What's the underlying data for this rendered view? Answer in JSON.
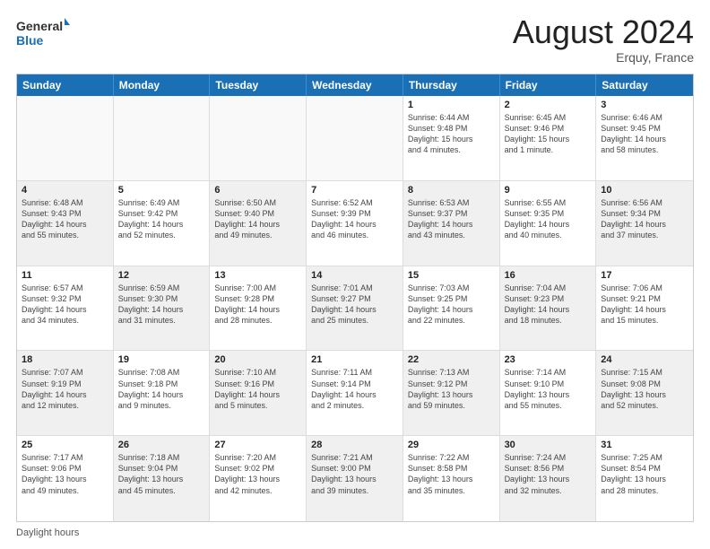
{
  "logo": {
    "line1": "General",
    "line2": "Blue"
  },
  "title": "August 2024",
  "location": "Erquy, France",
  "days_of_week": [
    "Sunday",
    "Monday",
    "Tuesday",
    "Wednesday",
    "Thursday",
    "Friday",
    "Saturday"
  ],
  "footer": "Daylight hours",
  "weeks": [
    [
      {
        "day": "",
        "info": "",
        "empty": true
      },
      {
        "day": "",
        "info": "",
        "empty": true
      },
      {
        "day": "",
        "info": "",
        "empty": true
      },
      {
        "day": "",
        "info": "",
        "empty": true
      },
      {
        "day": "1",
        "info": "Sunrise: 6:44 AM\nSunset: 9:48 PM\nDaylight: 15 hours\nand 4 minutes."
      },
      {
        "day": "2",
        "info": "Sunrise: 6:45 AM\nSunset: 9:46 PM\nDaylight: 15 hours\nand 1 minute."
      },
      {
        "day": "3",
        "info": "Sunrise: 6:46 AM\nSunset: 9:45 PM\nDaylight: 14 hours\nand 58 minutes."
      }
    ],
    [
      {
        "day": "4",
        "info": "Sunrise: 6:48 AM\nSunset: 9:43 PM\nDaylight: 14 hours\nand 55 minutes.",
        "shaded": true
      },
      {
        "day": "5",
        "info": "Sunrise: 6:49 AM\nSunset: 9:42 PM\nDaylight: 14 hours\nand 52 minutes."
      },
      {
        "day": "6",
        "info": "Sunrise: 6:50 AM\nSunset: 9:40 PM\nDaylight: 14 hours\nand 49 minutes.",
        "shaded": true
      },
      {
        "day": "7",
        "info": "Sunrise: 6:52 AM\nSunset: 9:39 PM\nDaylight: 14 hours\nand 46 minutes."
      },
      {
        "day": "8",
        "info": "Sunrise: 6:53 AM\nSunset: 9:37 PM\nDaylight: 14 hours\nand 43 minutes.",
        "shaded": true
      },
      {
        "day": "9",
        "info": "Sunrise: 6:55 AM\nSunset: 9:35 PM\nDaylight: 14 hours\nand 40 minutes."
      },
      {
        "day": "10",
        "info": "Sunrise: 6:56 AM\nSunset: 9:34 PM\nDaylight: 14 hours\nand 37 minutes.",
        "shaded": true
      }
    ],
    [
      {
        "day": "11",
        "info": "Sunrise: 6:57 AM\nSunset: 9:32 PM\nDaylight: 14 hours\nand 34 minutes."
      },
      {
        "day": "12",
        "info": "Sunrise: 6:59 AM\nSunset: 9:30 PM\nDaylight: 14 hours\nand 31 minutes.",
        "shaded": true
      },
      {
        "day": "13",
        "info": "Sunrise: 7:00 AM\nSunset: 9:28 PM\nDaylight: 14 hours\nand 28 minutes."
      },
      {
        "day": "14",
        "info": "Sunrise: 7:01 AM\nSunset: 9:27 PM\nDaylight: 14 hours\nand 25 minutes.",
        "shaded": true
      },
      {
        "day": "15",
        "info": "Sunrise: 7:03 AM\nSunset: 9:25 PM\nDaylight: 14 hours\nand 22 minutes."
      },
      {
        "day": "16",
        "info": "Sunrise: 7:04 AM\nSunset: 9:23 PM\nDaylight: 14 hours\nand 18 minutes.",
        "shaded": true
      },
      {
        "day": "17",
        "info": "Sunrise: 7:06 AM\nSunset: 9:21 PM\nDaylight: 14 hours\nand 15 minutes."
      }
    ],
    [
      {
        "day": "18",
        "info": "Sunrise: 7:07 AM\nSunset: 9:19 PM\nDaylight: 14 hours\nand 12 minutes.",
        "shaded": true
      },
      {
        "day": "19",
        "info": "Sunrise: 7:08 AM\nSunset: 9:18 PM\nDaylight: 14 hours\nand 9 minutes."
      },
      {
        "day": "20",
        "info": "Sunrise: 7:10 AM\nSunset: 9:16 PM\nDaylight: 14 hours\nand 5 minutes.",
        "shaded": true
      },
      {
        "day": "21",
        "info": "Sunrise: 7:11 AM\nSunset: 9:14 PM\nDaylight: 14 hours\nand 2 minutes."
      },
      {
        "day": "22",
        "info": "Sunrise: 7:13 AM\nSunset: 9:12 PM\nDaylight: 13 hours\nand 59 minutes.",
        "shaded": true
      },
      {
        "day": "23",
        "info": "Sunrise: 7:14 AM\nSunset: 9:10 PM\nDaylight: 13 hours\nand 55 minutes."
      },
      {
        "day": "24",
        "info": "Sunrise: 7:15 AM\nSunset: 9:08 PM\nDaylight: 13 hours\nand 52 minutes.",
        "shaded": true
      }
    ],
    [
      {
        "day": "25",
        "info": "Sunrise: 7:17 AM\nSunset: 9:06 PM\nDaylight: 13 hours\nand 49 minutes."
      },
      {
        "day": "26",
        "info": "Sunrise: 7:18 AM\nSunset: 9:04 PM\nDaylight: 13 hours\nand 45 minutes.",
        "shaded": true
      },
      {
        "day": "27",
        "info": "Sunrise: 7:20 AM\nSunset: 9:02 PM\nDaylight: 13 hours\nand 42 minutes."
      },
      {
        "day": "28",
        "info": "Sunrise: 7:21 AM\nSunset: 9:00 PM\nDaylight: 13 hours\nand 39 minutes.",
        "shaded": true
      },
      {
        "day": "29",
        "info": "Sunrise: 7:22 AM\nSunset: 8:58 PM\nDaylight: 13 hours\nand 35 minutes."
      },
      {
        "day": "30",
        "info": "Sunrise: 7:24 AM\nSunset: 8:56 PM\nDaylight: 13 hours\nand 32 minutes.",
        "shaded": true
      },
      {
        "day": "31",
        "info": "Sunrise: 7:25 AM\nSunset: 8:54 PM\nDaylight: 13 hours\nand 28 minutes."
      }
    ]
  ]
}
